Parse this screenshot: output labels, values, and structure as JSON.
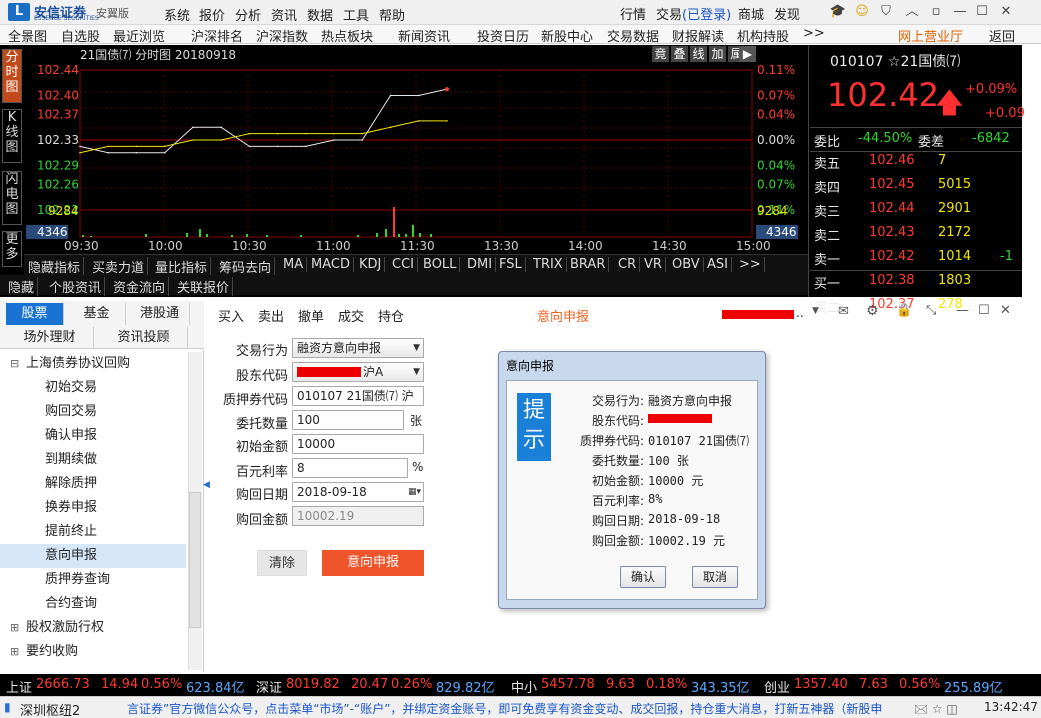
{
  "app": {
    "brand": "安信证券",
    "brand_sub": "ESSENCE SECURITIES",
    "edition": "安翼版"
  },
  "menu": [
    "系统",
    "报价",
    "分析",
    "资讯",
    "数据",
    "工具",
    "帮助"
  ],
  "topright": {
    "quote": "行情",
    "trade": "交易",
    "logged": "(已登录)",
    "mall": "商城",
    "discover": "发现"
  },
  "menu2": [
    "全景图",
    "自选股",
    "最近浏览",
    "沪深排名",
    "沪深指数",
    "热点板块",
    "新闻资讯",
    "投资日历",
    "新股中心",
    "交易数据",
    "财报解读",
    "机构持股",
    ">>",
    "网上营业厅",
    "返回"
  ],
  "chart": {
    "title": "21国债⑺ 分时图 20180918",
    "tools": [
      "竟",
      "叠",
      "线",
      "加",
      "属",
      "▶"
    ],
    "left_ticks": [
      "102.44",
      "102.40",
      "102.37",
      "102.33",
      "102.29",
      "102.26",
      "102.22"
    ],
    "right_ticks": [
      "0.11%",
      "0.07%",
      "0.04%",
      "0.00%",
      "0.04%",
      "0.07%",
      "0.11%"
    ],
    "vol_ticks": [
      "9284",
      "4346"
    ],
    "time_ticks": [
      "09:30",
      "10:00",
      "10:30",
      "11:00",
      "11:30",
      "13:30",
      "14:00",
      "14:30",
      "15:00"
    ],
    "left_tabs": [
      "分时图",
      "K线图",
      "闪电图",
      "更多"
    ]
  },
  "chart_data": {
    "type": "line",
    "title": "21国债⑺ 分时图 20180918",
    "x": [
      "09:30",
      "09:40",
      "09:50",
      "10:00",
      "10:10",
      "10:20",
      "10:30",
      "10:40",
      "10:50",
      "11:00",
      "11:10",
      "11:20",
      "11:25",
      "11:30"
    ],
    "series": [
      {
        "values": [
          102.32,
          102.31,
          102.31,
          102.31,
          102.35,
          102.35,
          102.32,
          102.32,
          102.32,
          102.33,
          102.33,
          102.4,
          102.4,
          102.41
        ]
      },
      {
        "values": [
          102.31,
          102.32,
          102.32,
          102.32,
          102.33,
          102.33,
          102.34,
          102.34,
          102.34,
          102.34,
          102.34,
          102.35,
          102.36,
          102.36
        ]
      }
    ],
    "ylim": [
      102.22,
      102.44
    ]
  },
  "chartbar": [
    "隐藏指标",
    "买卖力道",
    "量比指标",
    "筹码去向",
    "MA",
    "MACD",
    "KDJ",
    "CCI",
    "BOLL",
    "DMI",
    "FSL",
    "TRIX",
    "BRAR",
    "CR",
    "VR",
    "OBV",
    "ASI",
    ">>"
  ],
  "chartbar2": [
    "隐藏",
    "个股资讯",
    "资金流向",
    "关联报价"
  ],
  "quote": {
    "code": "010107",
    "star": "☆",
    "name": "21国债⑺",
    "price": "102.42",
    "pct": "+0.09%",
    "chg": "+0.09",
    "weibi_label": "委比",
    "weibi": "-44.50%",
    "weicha_label": "委差",
    "weicha": "-6842",
    "sells": [
      {
        "l": "卖五",
        "p": "102.46",
        "v": "7"
      },
      {
        "l": "卖四",
        "p": "102.45",
        "v": "5015"
      },
      {
        "l": "卖三",
        "p": "102.44",
        "v": "2901"
      },
      {
        "l": "卖二",
        "p": "102.43",
        "v": "2172"
      },
      {
        "l": "卖一",
        "p": "102.42",
        "v": "1014",
        "d": "-1"
      }
    ],
    "buys": [
      {
        "l": "买一",
        "p": "102.38",
        "v": "1803"
      },
      {
        "l": "买二",
        "p": "102.37",
        "v": "278"
      }
    ]
  },
  "nav": {
    "tabs": [
      "股票",
      "基金",
      "港股通",
      "场外理财",
      "资讯投顾"
    ],
    "tree": [
      {
        "t": "上海债券协议回购",
        "lvl": 0,
        "icon": "⊟"
      },
      {
        "t": "初始交易",
        "lvl": 1
      },
      {
        "t": "购回交易",
        "lvl": 1
      },
      {
        "t": "确认申报",
        "lvl": 1
      },
      {
        "t": "到期续做",
        "lvl": 1
      },
      {
        "t": "解除质押",
        "lvl": 1
      },
      {
        "t": "换券申报",
        "lvl": 1
      },
      {
        "t": "提前终止",
        "lvl": 1
      },
      {
        "t": "意向申报",
        "lvl": 1,
        "sel": true
      },
      {
        "t": "质押券查询",
        "lvl": 1
      },
      {
        "t": "合约查询",
        "lvl": 1
      },
      {
        "t": "股权激励行权",
        "lvl": 0,
        "icon": "⊞"
      },
      {
        "t": "要约收购",
        "lvl": 0,
        "icon": "⊞"
      }
    ]
  },
  "order": {
    "tabs": [
      "买入",
      "卖出",
      "撤单",
      "成交",
      "持仓"
    ],
    "form_title": "意向申报",
    "labels": [
      "交易行为",
      "股东代码",
      "质押券代码",
      "委托数量",
      "初始金额",
      "百元利率",
      "购回日期",
      "购回金额"
    ],
    "action": "融资方意向申报",
    "account_suffix": "沪A",
    "bond": "010107  21国债⑺ 沪",
    "qty": "100",
    "qty_unit": "张",
    "amount": "10000",
    "rate": "8",
    "rate_unit": "%",
    "date": "2018-09-18",
    "buyback": "10002.19",
    "clear": "清除",
    "submit": "意向申报"
  },
  "dialog": {
    "title": "意向申报",
    "icon": "提示",
    "labels": [
      "交易行为:",
      "股东代码:",
      "质押券代码:",
      "委托数量:",
      "初始金额:",
      "百元利率:",
      "购回日期:",
      "购回金额:"
    ],
    "values": [
      "融资方意向申报",
      "",
      "010107  21国债⑺",
      "100 张",
      "10000 元",
      "8%",
      "2018-09-18",
      "10002.19 元"
    ],
    "ok": "确认",
    "cancel": "取消"
  },
  "ticker": [
    {
      "n": "上证",
      "p": "2666.73",
      "c": "14.94",
      "r": "0.56%",
      "a": "623.84亿"
    },
    {
      "n": "深证",
      "p": "8019.82",
      "c": "20.47",
      "r": "0.26%",
      "a": "829.82亿"
    },
    {
      "n": "中小",
      "p": "5457.78",
      "c": "9.63",
      "r": "0.18%",
      "a": "343.35亿"
    },
    {
      "n": "创业",
      "p": "1357.40",
      "c": "7.63",
      "r": "0.56%",
      "a": "255.89亿"
    }
  ],
  "status": {
    "server": "深圳枢纽2",
    "marquee": "言证券”官方微信公众号，点击菜单“市场”-“账户”，并绑定资金账号，即可免费享有资金变动、成交回报，持仓重大消息，打新五神器（新股申",
    "time": "13:42:47"
  }
}
